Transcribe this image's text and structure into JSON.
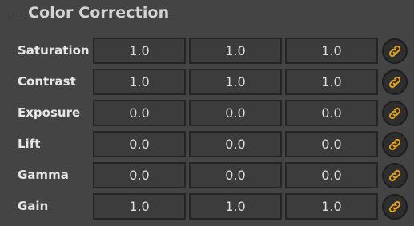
{
  "panel": {
    "title": "Color Correction"
  },
  "rows": [
    {
      "label": "Saturation",
      "values": [
        "1.0",
        "1.0",
        "1.0"
      ],
      "link_icon": "link-icon"
    },
    {
      "label": "Contrast",
      "values": [
        "1.0",
        "1.0",
        "1.0"
      ],
      "link_icon": "link-icon"
    },
    {
      "label": "Exposure",
      "values": [
        "0.0",
        "0.0",
        "0.0"
      ],
      "link_icon": "link-icon"
    },
    {
      "label": "Lift",
      "values": [
        "0.0",
        "0.0",
        "0.0"
      ],
      "link_icon": "link-icon"
    },
    {
      "label": "Gamma",
      "values": [
        "0.0",
        "0.0",
        "0.0"
      ],
      "link_icon": "link-icon"
    },
    {
      "label": "Gain",
      "values": [
        "1.0",
        "1.0",
        "1.0"
      ],
      "link_icon": "link-icon"
    }
  ],
  "colors": {
    "background": "#444444",
    "field_background": "#3c3c3c",
    "field_border": "#252525",
    "link_icon": "#e8a317",
    "label_text": "#e6e6e6"
  }
}
